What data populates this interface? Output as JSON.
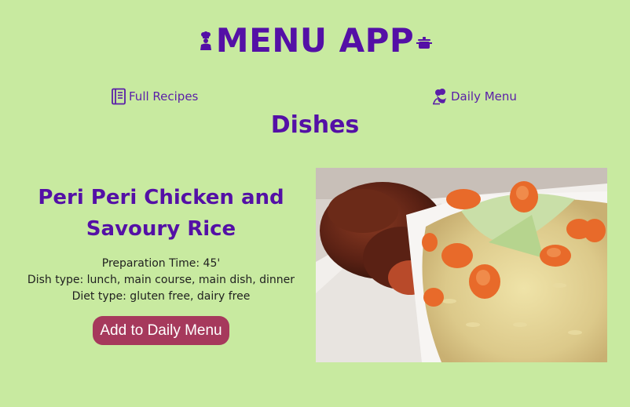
{
  "app": {
    "title": "MENU APP",
    "accent_color": "#5410a6",
    "background_color": "#c8eaa0",
    "left_icon": "chef-icon",
    "right_icon": "cooking-pot-icon"
  },
  "nav": {
    "full_recipes": {
      "label": "Full Recipes",
      "icon": "book-icon"
    },
    "daily_menu": {
      "label": "Daily Menu",
      "icon": "chef-hat-icon"
    }
  },
  "section": {
    "title": "Dishes"
  },
  "dish": {
    "name": "Peri Peri Chicken and Savoury Rice",
    "preparation_time": "Preparation Time: 45'",
    "dish_type": "Dish type: lunch, main course, main dish, dinner",
    "diet_type": "Diet type: gluten free, dairy free",
    "add_button_label": "Add to Daily Menu",
    "add_button_color": "#a6395c"
  }
}
